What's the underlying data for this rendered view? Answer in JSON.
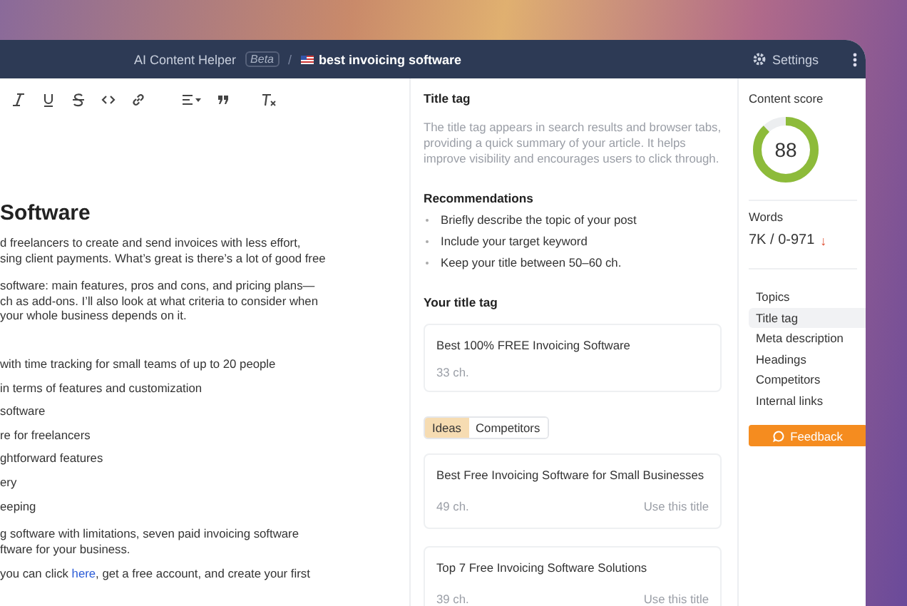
{
  "header": {
    "app_name": "AI Content Helper",
    "badge": "Beta",
    "separator": "/",
    "keyword": "best invoicing software",
    "settings": "Settings"
  },
  "editor": {
    "heading": "Software",
    "blocks": [
      {
        "kind": "paragraph",
        "lines": [
          "d freelancers to create and send invoices with less effort,",
          "sing client payments. What’s great is there’s a lot of good free"
        ]
      },
      {
        "kind": "paragraph",
        "lines": [
          "software: main features, pros and cons, and pricing plans—",
          "ch as add-ons. I’ll also look at what criteria to consider when",
          "your whole business depends on it."
        ]
      },
      {
        "kind": "list",
        "lines": [
          "with time tracking for small teams of up to 20 people",
          "in terms of features and customization",
          "software",
          "re for freelancers",
          "ghtforward features",
          "ery",
          "eeping"
        ]
      },
      {
        "kind": "paragraph",
        "lines": [
          "g software with limitations, seven paid invoicing software",
          "ftware for your business."
        ]
      },
      {
        "kind": "link_line",
        "before": "you can click ",
        "link": "here",
        "after": ", get a free account, and create your first"
      }
    ]
  },
  "title_tag": {
    "title": "Title tag",
    "description": "The title tag appears in search results and browser tabs, providing a quick summary of your article. It helps improve visibility and encourages users to click through.",
    "recommendations_title": "Recommendations",
    "recommendations": [
      "Briefly describe the topic of your post",
      "Include your target keyword",
      "Keep your title between 50–60 ch."
    ],
    "your_title_heading": "Your title tag",
    "current": {
      "text": "Best 100% FREE Invoicing Software",
      "count": "33 ch."
    },
    "tabs": [
      {
        "label": "Ideas",
        "selected": true
      },
      {
        "label": "Competitors",
        "selected": false
      }
    ],
    "ideas": [
      {
        "text": "Best Free Invoicing Software for Small Businesses",
        "count": "49 ch.",
        "action": "Use this title"
      },
      {
        "text": "Top 7 Free Invoicing Software Solutions",
        "count": "39 ch.",
        "action": "Use this title"
      }
    ]
  },
  "sidebar": {
    "score": {
      "label": "Content score",
      "value": "88",
      "level": 0.88
    },
    "words": {
      "label": "Words",
      "value": "7K / 0-971",
      "trend_arrow": "↓"
    },
    "nav": [
      {
        "label": "Topics",
        "selected": false
      },
      {
        "label": "Title tag",
        "selected": true
      },
      {
        "label": "Meta description",
        "selected": false
      },
      {
        "label": "Headings",
        "selected": false
      },
      {
        "label": "Competitors",
        "selected": false
      },
      {
        "label": "Internal links",
        "selected": false
      }
    ],
    "feedback": "Feedback"
  }
}
